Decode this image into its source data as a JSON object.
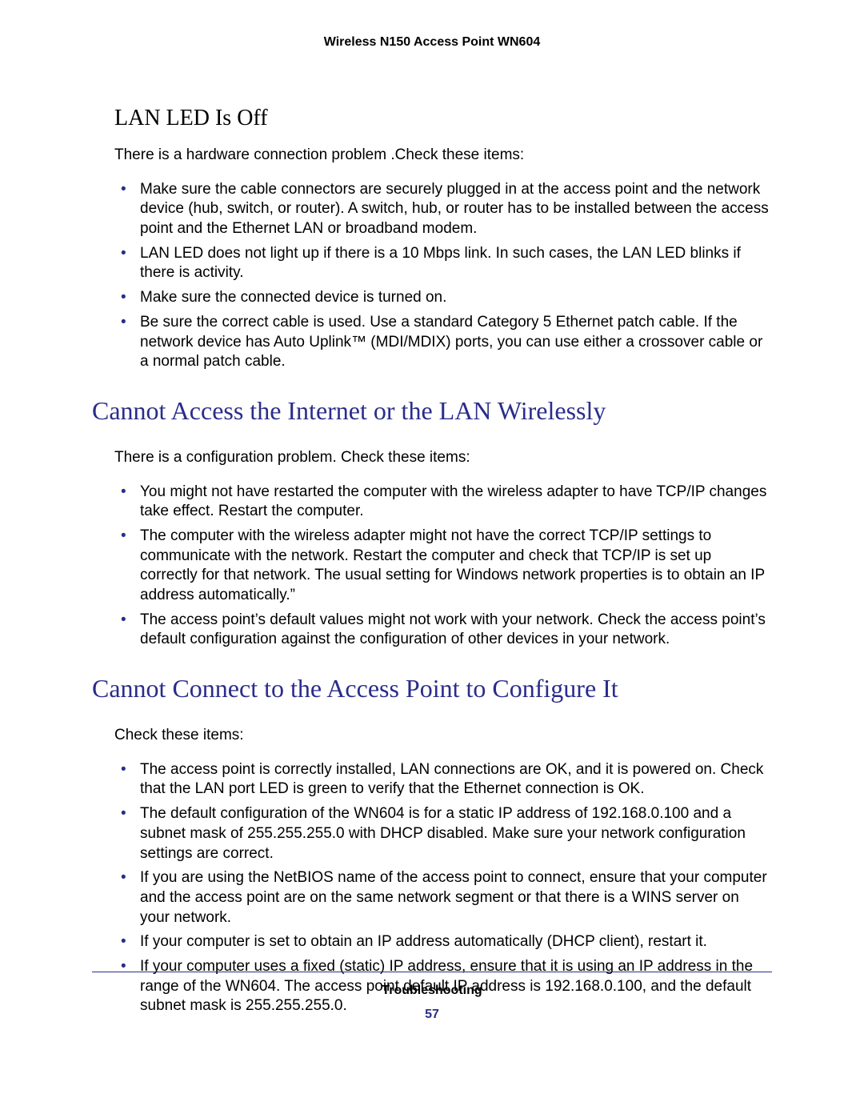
{
  "header": "Wireless N150 Access Point WN604",
  "section1": {
    "title": "LAN LED Is Off",
    "intro": "There is a hardware connection problem .Check these items:",
    "items": [
      "Make sure the cable connectors are securely plugged in at the access point and the network device (hub, switch, or router). A switch, hub, or router has to be installed between the access point and the Ethernet LAN or broadband modem.",
      "LAN LED does not light up if there is a 10 Mbps link. In such cases, the LAN LED blinks if there is activity.",
      "Make sure the connected device is turned on.",
      "Be sure the correct cable is used. Use a standard Category 5 Ethernet patch cable. If the network device has Auto Uplink™ (MDI/MDIX) ports, you can use either a crossover cable or a normal patch cable."
    ]
  },
  "section2": {
    "title": "Cannot Access the Internet or the LAN Wirelessly",
    "intro": "There is a configuration problem. Check these items:",
    "items": [
      "You might not have restarted the computer with the wireless adapter to have TCP/IP changes take effect. Restart the computer.",
      "The computer with the wireless adapter might not have the correct TCP/IP settings to communicate with the network. Restart the computer and check that TCP/IP is set up correctly for that network. The usual setting for Windows network properties is to obtain an IP address automatically.”",
      "The access point’s default values might not work with your network. Check the access point’s default configuration against the configuration of other devices in your network."
    ]
  },
  "section3": {
    "title": "Cannot Connect to the Access Point to Configure It",
    "intro": "Check these items:",
    "items": [
      "The access point is correctly installed, LAN connections are OK, and it is powered on. Check that the LAN port LED is green to verify that the Ethernet connection is OK.",
      "The default configuration of the WN604 is for a static IP address of 192.168.0.100 and a subnet mask of 255.255.255.0 with DHCP disabled. Make sure your network configuration settings are correct.",
      "If you are using the NetBIOS name of the access point to connect, ensure that your computer and the access point are on the same network segment or that there is a WINS server on your network.",
      "If your computer is set to obtain an IP address automatically (DHCP client), restart it.",
      "If your computer uses a fixed (static) IP address, ensure that it is using an IP address in the range of the WN604. The access point default IP address is 192.168.0.100, and the default subnet mask is 255.255.255.0."
    ]
  },
  "footer": {
    "label": "Troubleshooting",
    "page": "57"
  }
}
